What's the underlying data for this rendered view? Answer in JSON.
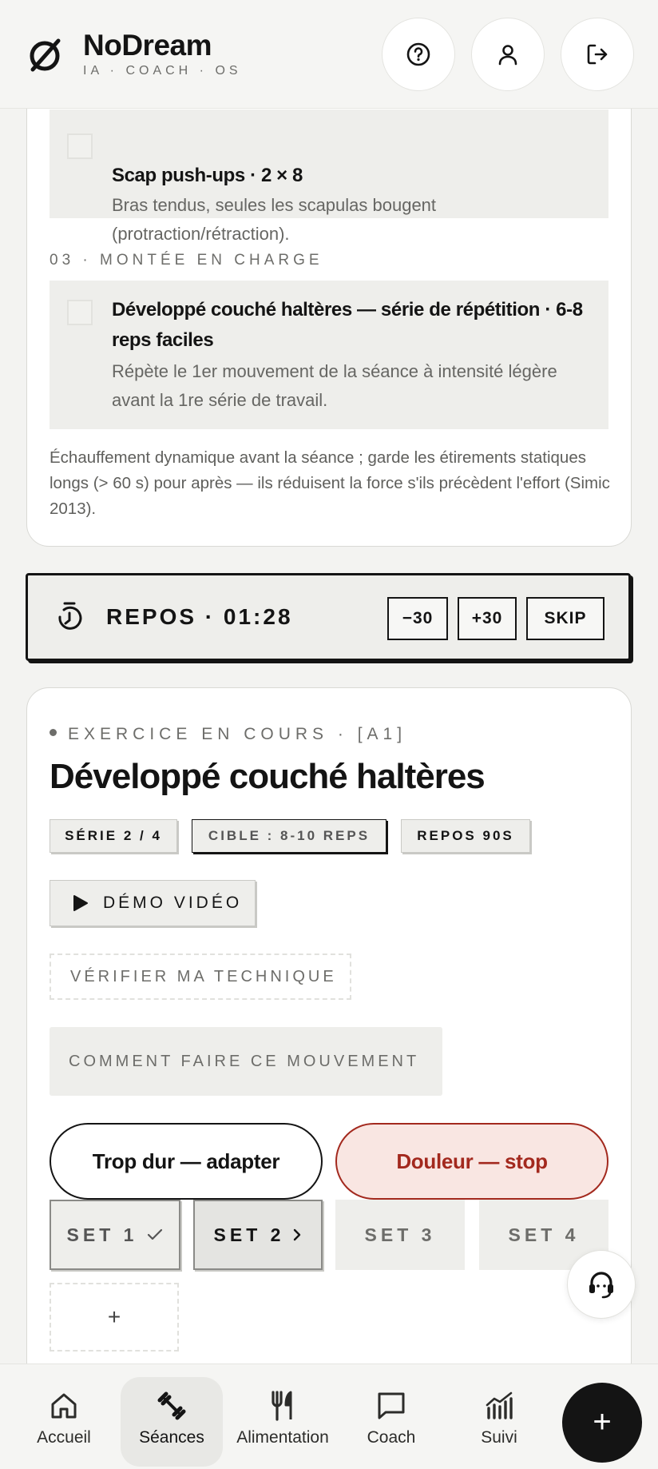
{
  "app": {
    "name": "NoDream",
    "tagline": "IA · COACH · OS"
  },
  "header": {
    "help_icon": "question-circle-icon",
    "profile_icon": "user-icon",
    "logout_icon": "logout-icon"
  },
  "warmup": {
    "step_scap": {
      "title": "Scap push-ups · 2 × 8",
      "desc": "Bras tendus, seules les scapulas bougent (protraction/rétraction)."
    },
    "section_03": "03 · MONTÉE EN CHARGE",
    "step_dev": {
      "title": "Développé couché haltères — série de répétition · 6-8 reps faciles",
      "desc": "Répète le 1er mouvement de la séance à intensité légère avant la 1re série de travail."
    },
    "note": "Échauffement dynamique avant la séance ; garde les étirements statiques longs (> 60 s) pour après — ils réduisent la force s'ils précèdent l'effort (Simic 2013)."
  },
  "rest": {
    "label": "REPOS · 01:28",
    "minus": "−30",
    "plus": "+30",
    "skip": "SKIP"
  },
  "exercise": {
    "eyebrow": "EXERCICE EN COURS · [A1]",
    "title": "Développé couché haltères",
    "tags": [
      "SÉRIE 2 / 4",
      "CIBLE : 8-10 REPS",
      "REPOS 90S"
    ],
    "demo": "DÉMO VIDÉO",
    "verify": "VÉRIFIER MA TECHNIQUE",
    "how": "COMMENT FAIRE CE MOUVEMENT",
    "too_hard": "Trop dur — adapter",
    "pain": "Douleur — stop",
    "sets": [
      "SET 1",
      "SET 2",
      "SET 3",
      "SET 4"
    ],
    "add_set": "+"
  },
  "nav": {
    "items": [
      "Accueil",
      "Séances",
      "Alimentation",
      "Coach",
      "Suivi"
    ],
    "active": "Séances",
    "fab": "+"
  },
  "colors": {
    "ink": "#141414",
    "danger": "#a3291e",
    "danger_bg": "#f9e6e2",
    "surface": "#eeeeeb"
  }
}
